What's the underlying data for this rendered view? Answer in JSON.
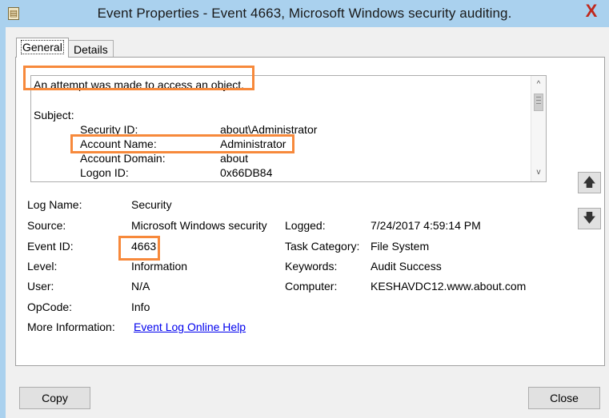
{
  "window": {
    "title": "Event Properties - Event 4663, Microsoft Windows security auditing.",
    "close_glyph": "X"
  },
  "tabs": [
    {
      "label": "General",
      "selected": true
    },
    {
      "label": "Details",
      "selected": false
    }
  ],
  "description": {
    "headline": "An attempt was made to access an object.",
    "subject_label": "Subject:",
    "rows": [
      {
        "label": "Security ID:",
        "value": "about\\Administrator"
      },
      {
        "label": "Account Name:",
        "value": "Administrator"
      },
      {
        "label": "Account Domain:",
        "value": "about"
      },
      {
        "label": "Logon ID:",
        "value": "0x66DB84"
      }
    ]
  },
  "fields": {
    "log_name": {
      "label": "Log Name:",
      "value": "Security"
    },
    "source": {
      "label": "Source:",
      "value": "Microsoft Windows security"
    },
    "logged": {
      "label": "Logged:",
      "value": "7/24/2017 4:59:14 PM"
    },
    "event_id": {
      "label": "Event ID:",
      "value": "4663"
    },
    "task_category": {
      "label": "Task Category:",
      "value": "File System"
    },
    "level": {
      "label": "Level:",
      "value": "Information"
    },
    "keywords": {
      "label": "Keywords:",
      "value": "Audit Success"
    },
    "user": {
      "label": "User:",
      "value": "N/A"
    },
    "computer": {
      "label": "Computer:",
      "value": "KESHAVDC12.www.about.com"
    },
    "opcode": {
      "label": "OpCode:",
      "value": "Info"
    },
    "more_info": {
      "label": "More Information:",
      "value": "Event Log Online Help"
    }
  },
  "buttons": {
    "copy": "Copy",
    "close": "Close"
  },
  "icons": {
    "up_arrow": "🡅",
    "down_arrow": "🡇",
    "scroll_up": "^",
    "scroll_down": "v"
  },
  "colors": {
    "highlight": "#f7893b",
    "titlebar": "#aad1ee",
    "link": "#0000ee"
  }
}
